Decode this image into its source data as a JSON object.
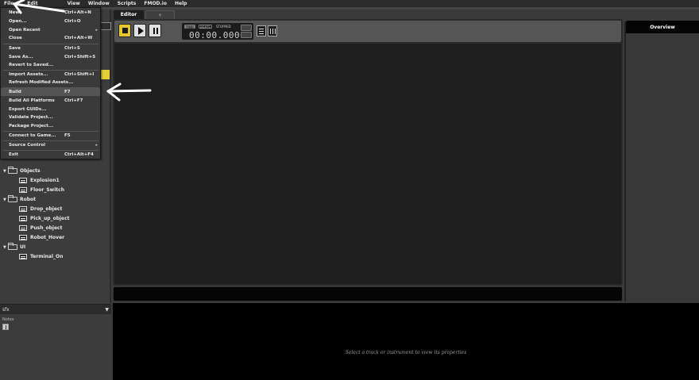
{
  "menubar": {
    "items": [
      "File",
      "Edit",
      "View",
      "Window",
      "Scripts",
      "FMOD.io",
      "Help"
    ]
  },
  "file_menu": {
    "items": [
      {
        "label": "New",
        "shortcut": "Ctrl+Alt+N"
      },
      {
        "label": "Open...",
        "shortcut": "Ctrl+O"
      },
      {
        "label": "Open Recent",
        "shortcut": "",
        "submenu": "▸"
      },
      {
        "label": "Close",
        "shortcut": "Ctrl+Alt+W"
      },
      {
        "label": "Save",
        "shortcut": "Ctrl+S"
      },
      {
        "label": "Save As...",
        "shortcut": "Ctrl+Shift+S"
      },
      {
        "label": "Revert to Saved...",
        "shortcut": ""
      },
      {
        "label": "Import Assets...",
        "shortcut": "Ctrl+Shift+I"
      },
      {
        "label": "Refresh Modified Assets...",
        "shortcut": ""
      },
      {
        "label": "Build",
        "shortcut": "F7"
      },
      {
        "label": "Build All Platforms",
        "shortcut": "Ctrl+F7"
      },
      {
        "label": "Export GUIDs...",
        "shortcut": ""
      },
      {
        "label": "Validate Project...",
        "shortcut": ""
      },
      {
        "label": "Package Project...",
        "shortcut": ""
      },
      {
        "label": "Connect to Game...",
        "shortcut": "F5"
      },
      {
        "label": "Source Control",
        "shortcut": "",
        "submenu": "▸"
      },
      {
        "label": "Exit",
        "shortcut": "Ctrl+Alt+F4"
      }
    ]
  },
  "tree": {
    "items": [
      {
        "label": "Objects",
        "type": "folder"
      },
      {
        "label": "Explosion1",
        "type": "event"
      },
      {
        "label": "Floor_Switch",
        "type": "event"
      },
      {
        "label": "Robot",
        "type": "folder"
      },
      {
        "label": "Drop_object",
        "type": "event"
      },
      {
        "label": "Pick_up_object",
        "type": "event"
      },
      {
        "label": "Push_object",
        "type": "event"
      },
      {
        "label": "Robot_Hover",
        "type": "event"
      },
      {
        "label": "UI",
        "type": "folder"
      },
      {
        "label": "Terminal_On",
        "type": "event"
      }
    ]
  },
  "bottom_left": {
    "title": "sfx",
    "notes_label": "Notes"
  },
  "tabs": {
    "editor": "Editor",
    "add": "+"
  },
  "transport": {
    "tag_time": "TIME",
    "tag_beats": "BEATS",
    "state": "STOPPED",
    "time": "00:00.000"
  },
  "overview": {
    "title": "Overview"
  },
  "properties": {
    "hint": "Select a track or instrument to view its properties"
  },
  "colors": {
    "accent": "#e8c72c",
    "annotation": "#ffffff"
  }
}
